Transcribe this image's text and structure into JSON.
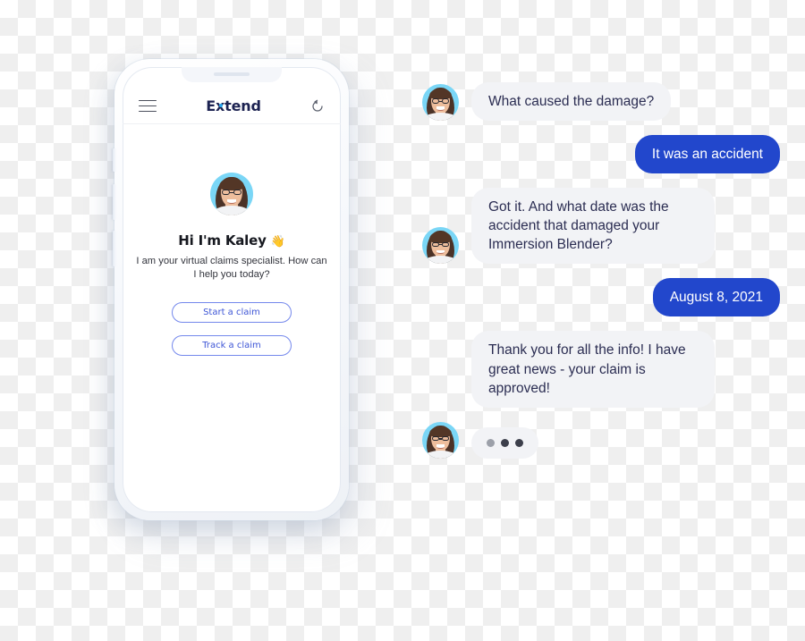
{
  "phone": {
    "header": {
      "menu_icon": "hamburger-menu-icon",
      "brand": "Extend",
      "refresh_icon": "refresh-icon"
    },
    "avatar_name": "kaley-avatar",
    "greeting": "Hi I'm Kaley",
    "greeting_emoji": "👋",
    "subtitle": "I am your virtual claims specialist. How can I help you today?",
    "buttons": [
      {
        "label": "Start a claim",
        "name": "start-a-claim-button"
      },
      {
        "label": "Track a claim",
        "name": "track-a-claim-button"
      }
    ]
  },
  "chat": {
    "messages": [
      {
        "sender": "bot",
        "text": "What caused the damage?",
        "avatar": true
      },
      {
        "sender": "user",
        "text": "It was an accident",
        "avatar": false
      },
      {
        "sender": "bot",
        "text": "Got it. And what date was the accident that damaged your Immersion Blender?",
        "avatar": true
      },
      {
        "sender": "user",
        "text": "August 8, 2021",
        "avatar": false
      },
      {
        "sender": "bot",
        "text": "Thank you for all the info! I have great news - your claim is approved!",
        "avatar": false
      },
      {
        "sender": "bot",
        "text": "",
        "avatar": true,
        "typing": true
      }
    ]
  },
  "colors": {
    "user_bubble": "#2247cc",
    "bot_bubble": "#f2f3f6",
    "bot_text": "#2b2d52",
    "avatar_bg": "#7ad6f6",
    "cta_border": "#7488ec",
    "cta_text": "#3e56d6",
    "brand_text": "#1c2251",
    "brand_accent": "#2aa8ef",
    "typing_dot_light": "#9ca0a9",
    "typing_dot_dark": "#3c3f4b",
    "checker_light": "#ffffff",
    "checker_dark": "#efefef"
  }
}
